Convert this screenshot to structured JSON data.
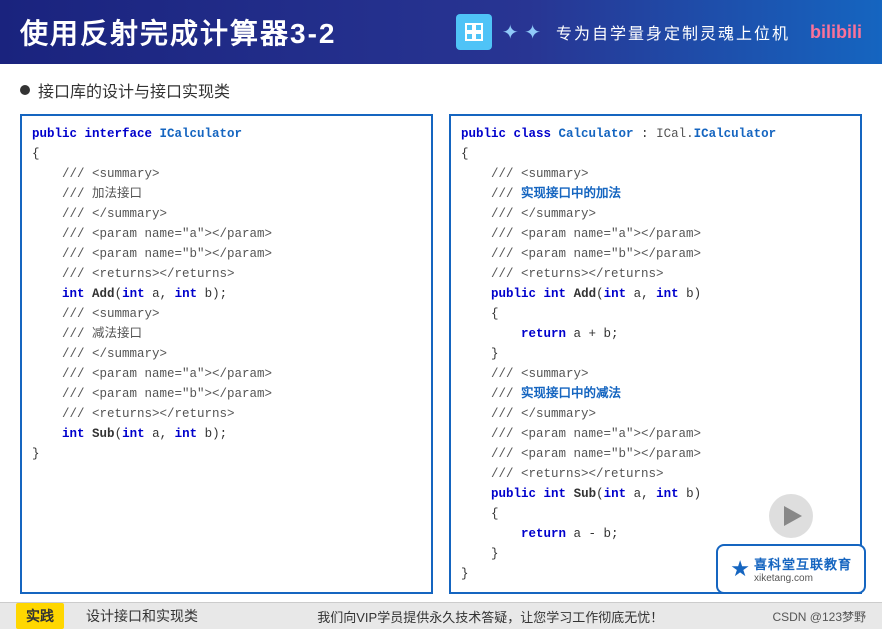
{
  "header": {
    "title": "使用反射完成计算器3-2",
    "slogan": "专为自学量身定制灵魂上位机",
    "bilibili": "bilibili",
    "icon_label": "▣"
  },
  "section": {
    "bullet_label": "•",
    "title": "接口库的设计与接口实现类"
  },
  "left_panel": {
    "lines": [
      {
        "text": "public interface ICalculator"
      },
      {
        "text": "{"
      },
      {
        "text": "    /// <summary>"
      },
      {
        "text": "    /// 加法接口"
      },
      {
        "text": "    /// </summary>"
      },
      {
        "text": "    /// <param name=\"a\"></param>"
      },
      {
        "text": "    /// <param name=\"b\"></param>"
      },
      {
        "text": "    /// <returns></returns>"
      },
      {
        "text": "    int Add(int a, int b);"
      },
      {
        "text": "    /// <summary>"
      },
      {
        "text": "    /// 减法接口"
      },
      {
        "text": "    /// </summary>"
      },
      {
        "text": "    /// <param name=\"a\"></param>"
      },
      {
        "text": "    /// <param name=\"b\"></param>"
      },
      {
        "text": "    /// <returns></returns>"
      },
      {
        "text": "    int Sub(int a, int b);"
      },
      {
        "text": "}"
      }
    ]
  },
  "right_panel": {
    "lines": [
      {
        "text": "public class Calculator : ICal.ICalculator"
      },
      {
        "text": "{"
      },
      {
        "text": "    /// <summary>"
      },
      {
        "text": "    /// 实现接口中的加法"
      },
      {
        "text": "    /// </summary>"
      },
      {
        "text": "    /// <param name=\"a\"></param>"
      },
      {
        "text": "    /// <param name=\"b\"></param>"
      },
      {
        "text": "    /// <returns></returns>"
      },
      {
        "text": "    public int Add(int a, int b)"
      },
      {
        "text": "    {"
      },
      {
        "text": "        return a + b;"
      },
      {
        "text": "    }"
      },
      {
        "text": "    /// <summary>"
      },
      {
        "text": "    /// 实现接口中的减法"
      },
      {
        "text": "    /// </summary>"
      },
      {
        "text": "    /// <param name=\"a\"></param>"
      },
      {
        "text": "    /// <param name=\"b\"></param>"
      },
      {
        "text": "    /// <returns></returns>"
      },
      {
        "text": "    public int Sub(int a, int b)"
      },
      {
        "text": "    {"
      },
      {
        "text": "        return a - b;"
      },
      {
        "text": "    }"
      },
      {
        "text": "}"
      }
    ]
  },
  "logo": {
    "star": "★",
    "name_cn": "喜科堂互联教育",
    "name_en": "xiketang.com"
  },
  "footer": {
    "tab_active": "实践",
    "tab_inactive": "设计接口和实现类",
    "center_text": "我们向VIP学员提供永久技术答疑，让您学习工作彻底无忧！",
    "right_text": "CSDN @123梦野"
  }
}
